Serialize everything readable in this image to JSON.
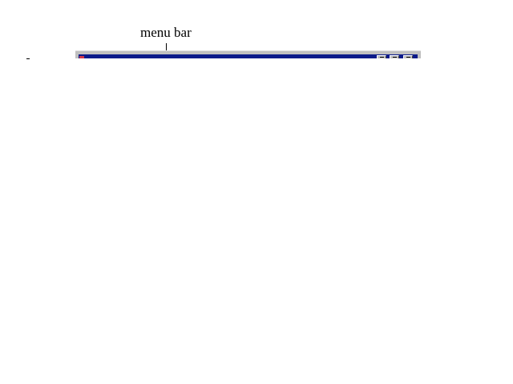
{
  "annotation": {
    "label": "menu bar"
  },
  "window": {
    "title": "",
    "icon": "application-icon",
    "controls": [
      "minimize-icon",
      "maximize-icon",
      "close-icon"
    ],
    "title_bar_color": "#0a1a8a",
    "frame_color": "#c0c0c0"
  }
}
